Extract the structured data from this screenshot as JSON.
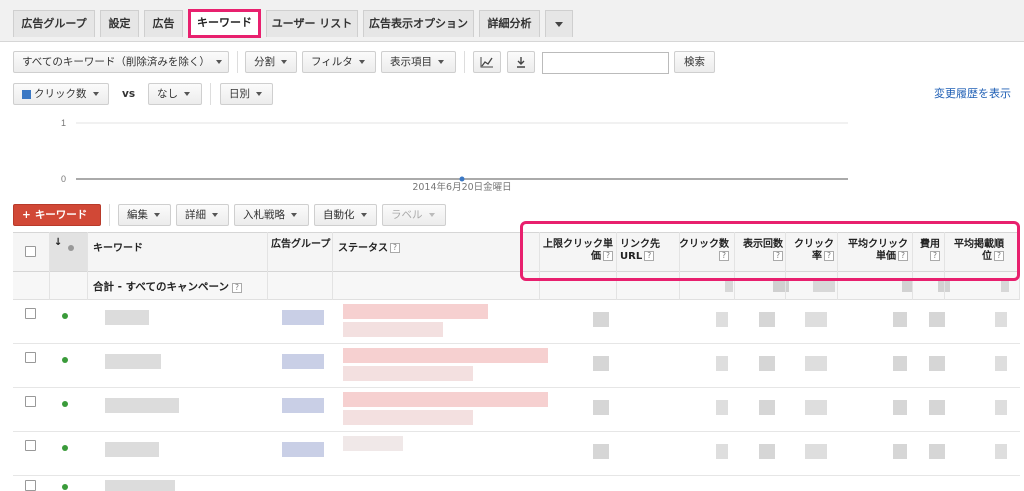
{
  "tabs": [
    {
      "label": "広告グループ"
    },
    {
      "label": "設定"
    },
    {
      "label": "広告"
    },
    {
      "label": "キーワード"
    },
    {
      "label": "ユーザー リスト"
    },
    {
      "label": "広告表示オプション"
    },
    {
      "label": "詳細分析"
    }
  ],
  "toolbar1": {
    "filter_all": "すべてのキーワード（削除済みを除く）",
    "segment": "分割",
    "filter": "フィルタ",
    "columns": "表示項目",
    "search_button": "検索",
    "search_value": ""
  },
  "toolbar2": {
    "metric1": "クリック数",
    "vs": "vs",
    "metric2": "なし",
    "period": "日別",
    "history_link": "変更履歴を表示"
  },
  "chart_data": {
    "type": "line",
    "x": [
      "2014年6月20日金曜日"
    ],
    "series": [
      {
        "values": [
          0
        ]
      }
    ],
    "y_ticks": [
      "1",
      "0"
    ],
    "ylim": [
      0,
      1
    ],
    "x_label_text": "2014年6月20日金曜日",
    "grid": true
  },
  "toolbar3": {
    "add_keyword": "キーワード",
    "edit": "編集",
    "detail": "詳細",
    "bid_strategy": "入札戦略",
    "automate": "自動化",
    "label": "ラベル"
  },
  "table": {
    "headers": {
      "keyword": "キーワード",
      "adgroup": "広告グループ",
      "status": "ステータス",
      "max_cpc": "上限クリック単価",
      "dest_url": "リンク先URL",
      "clicks": "クリック数",
      "impressions": "表示回数",
      "ctr": "クリック率",
      "avg_cpc": "平均クリック単価",
      "cost": "費用",
      "avg_pos": "平均掲載順位"
    },
    "summary_label": "合計 - すべてのキャンペーン",
    "help": "?"
  },
  "colors": {
    "accent": "#e8206e",
    "status_dot": "#3a9b3a",
    "add_button": "#d14836",
    "link": "#1f5fb5",
    "chart_metric": "#3b78c4"
  }
}
